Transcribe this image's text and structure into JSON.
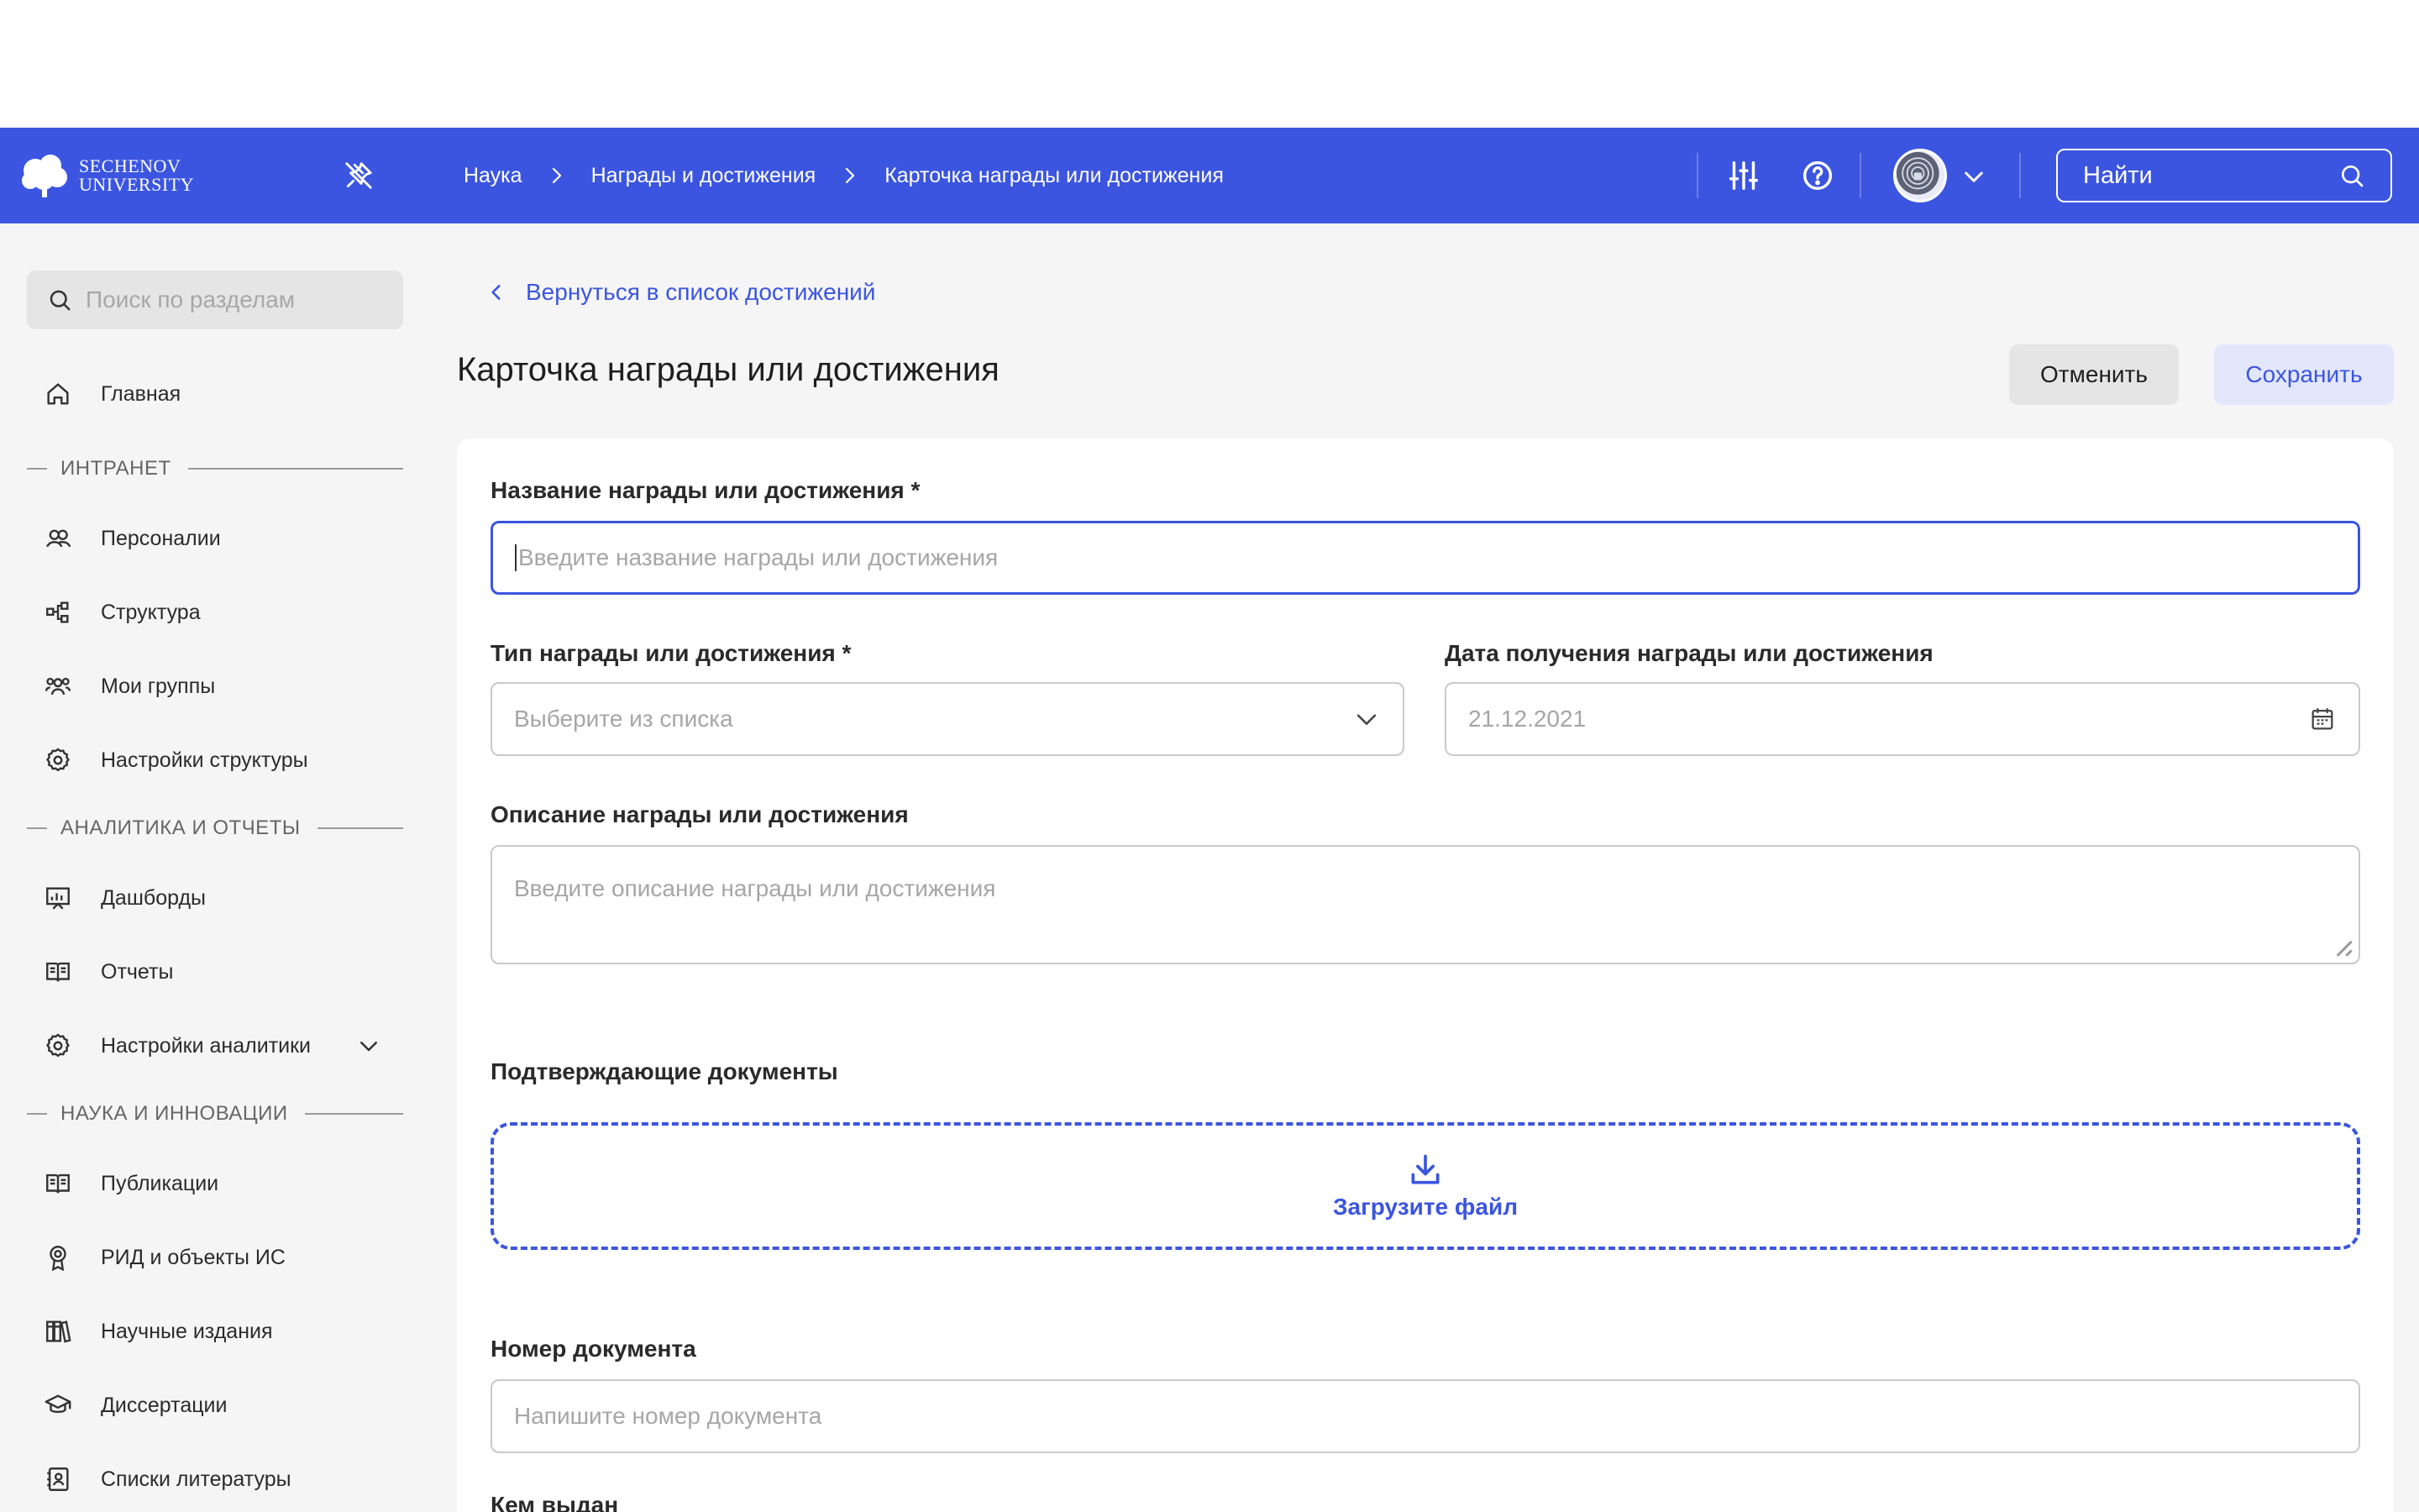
{
  "header": {
    "logo_line1": "SECHENOV",
    "logo_line2": "UNIVERSITY",
    "breadcrumbs": [
      "Наука",
      "Награды и достижения",
      "Карточка награды или достижения"
    ],
    "search_placeholder": "Найти",
    "icons": [
      "pin-off-icon",
      "filters-icon",
      "help-icon",
      "avatar",
      "chevron-down-icon",
      "search-icon"
    ]
  },
  "sidebar": {
    "search_placeholder": "Поиск по разделам",
    "home": "Главная",
    "sections": [
      {
        "title": "ИНТРАНЕТ",
        "items": [
          {
            "label": "Персоналии",
            "icon": "people-icon"
          },
          {
            "label": "Структура",
            "icon": "structure-icon"
          },
          {
            "label": "Мои группы",
            "icon": "groups-icon"
          },
          {
            "label": "Настройки структуры",
            "icon": "gear-icon"
          }
        ]
      },
      {
        "title": "АНАЛИТИКА И ОТЧЕТЫ",
        "items": [
          {
            "label": "Дашборды",
            "icon": "dashboard-icon"
          },
          {
            "label": "Отчеты",
            "icon": "book-icon"
          },
          {
            "label": "Настройки аналитики",
            "icon": "gear-icon"
          }
        ]
      },
      {
        "title": "НАУКА И ИННОВАЦИИ",
        "items": [
          {
            "label": "Публикации",
            "icon": "book-icon"
          },
          {
            "label": "РИД и объекты ИС",
            "icon": "award-icon"
          },
          {
            "label": "Научные издания",
            "icon": "books-icon"
          },
          {
            "label": "Диссертации",
            "icon": "graduation-cap-icon"
          },
          {
            "label": "Списки литературы",
            "icon": "contacts-book-icon"
          }
        ]
      }
    ]
  },
  "main": {
    "back_link": "Вернуться в список достижений",
    "title": "Карточка награды или достижения",
    "cancel_label": "Отменить",
    "save_label": "Сохранить",
    "form": {
      "name_label": "Название награды или достижения",
      "name_placeholder": "Введите название награды или достижения",
      "type_label": "Тип награды или достижения",
      "type_placeholder": "Выберите из списка",
      "date_label": "Дата получения награды или достижения",
      "date_placeholder": "21.12.2021",
      "desc_label": "Описание награды или достижения",
      "desc_placeholder": "Введите описание награды или достижения",
      "docs_label": "Подтверждающие документы",
      "upload_label": "Загрузите файл",
      "docnum_label": "Номер документа",
      "docnum_placeholder": "Напишите номер документа",
      "issuer_label": "Кем выдан",
      "required_mark": "*"
    }
  },
  "colors": {
    "accent": "#3b55e0",
    "header_bg": "#3b55e0",
    "page_bg": "#f5f5f5",
    "save_bg": "#e3e7fb",
    "cancel_bg": "#e5e5e5"
  }
}
